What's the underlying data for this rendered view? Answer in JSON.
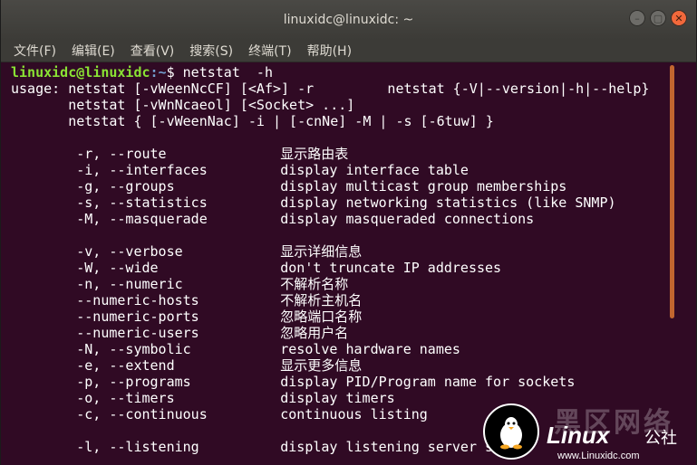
{
  "window": {
    "title": "linuxidc@linuxidc: ~",
    "buttons": {
      "minimize": "–",
      "maximize": "▢",
      "close": "✕"
    }
  },
  "menu": [
    "文件(F)",
    "编辑(E)",
    "查看(V)",
    "搜索(S)",
    "终端(T)",
    "帮助(H)"
  ],
  "prompt": {
    "user_host": "linuxidc@linuxidc",
    "path": ":~",
    "symbol": "$",
    "command": " netstat  -h"
  },
  "usage_lines": [
    "usage: netstat [-vWeenNcCF] [<Af>] -r         netstat {-V|--version|-h|--help}",
    "       netstat [-vWnNcaeol] [<Socket> ...]",
    "       netstat { [-vWeenNac] -i | [-cnNe] -M | -s [-6tuw] }"
  ],
  "options": [
    {
      "opt": "-r, --route",
      "desc": "显示路由表"
    },
    {
      "opt": "-i, --interfaces",
      "desc": "display interface table"
    },
    {
      "opt": "-g, --groups",
      "desc": "display multicast group memberships"
    },
    {
      "opt": "-s, --statistics",
      "desc": "display networking statistics (like SNMP)"
    },
    {
      "opt": "-M, --masquerade",
      "desc": "display masqueraded connections"
    },
    {
      "opt": "",
      "desc": ""
    },
    {
      "opt": "-v, --verbose",
      "desc": "显示详细信息"
    },
    {
      "opt": "-W, --wide",
      "desc": "don't truncate IP addresses"
    },
    {
      "opt": "-n, --numeric",
      "desc": "不解析名称"
    },
    {
      "opt": "--numeric-hosts",
      "desc": "不解析主机名"
    },
    {
      "opt": "--numeric-ports",
      "desc": "忽略端口名称"
    },
    {
      "opt": "--numeric-users",
      "desc": "忽略用户名"
    },
    {
      "opt": "-N, --symbolic",
      "desc": "resolve hardware names"
    },
    {
      "opt": "-e, --extend",
      "desc": "显示更多信息"
    },
    {
      "opt": "-p, --programs",
      "desc": "display PID/Program name for sockets"
    },
    {
      "opt": "-o, --timers",
      "desc": "display timers"
    },
    {
      "opt": "-c, --continuous",
      "desc": "continuous listing"
    },
    {
      "opt": "",
      "desc": ""
    },
    {
      "opt": "-l, --listening",
      "desc": "display listening server s"
    }
  ],
  "watermark": {
    "cn": "黑区网络",
    "brand": "Linux",
    "brand_suffix": "公社",
    "url": "www.Linuxidc.com"
  }
}
